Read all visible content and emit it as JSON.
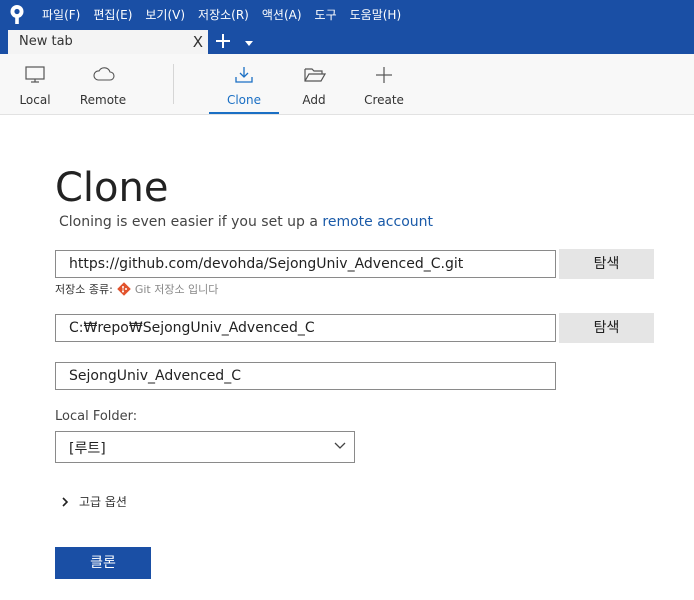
{
  "menu": [
    "파일(F)",
    "편집(E)",
    "보기(V)",
    "저장소(R)",
    "액션(A)",
    "도구",
    "도움말(H)"
  ],
  "tab": {
    "title": "New tab",
    "close": "X"
  },
  "toolbar": {
    "local": "Local",
    "remote": "Remote",
    "clone": "Clone",
    "add": "Add",
    "create": "Create"
  },
  "page": {
    "title": "Clone",
    "subtitle_prefix": "Cloning is even easier if you set up a ",
    "subtitle_link": "remote account"
  },
  "form": {
    "url_value": "https://github.com/devohda/SejongUniv_Advenced_C.git",
    "browse1": "탐색",
    "repo_type_label": "저장소 종류:",
    "repo_type_value": "Git 저장소 입니다",
    "path_value": "C:₩repo₩SejongUniv_Advenced_C",
    "browse2": "탐색",
    "name_value": "SejongUniv_Advenced_C",
    "local_folder_label": "Local Folder:",
    "local_folder_value": "[루트]",
    "advanced": "고급 옵션",
    "clone_button": "클론"
  },
  "colors": {
    "accent": "#1a4fa5",
    "link": "#1a5aa8",
    "git": "#e2532d"
  }
}
